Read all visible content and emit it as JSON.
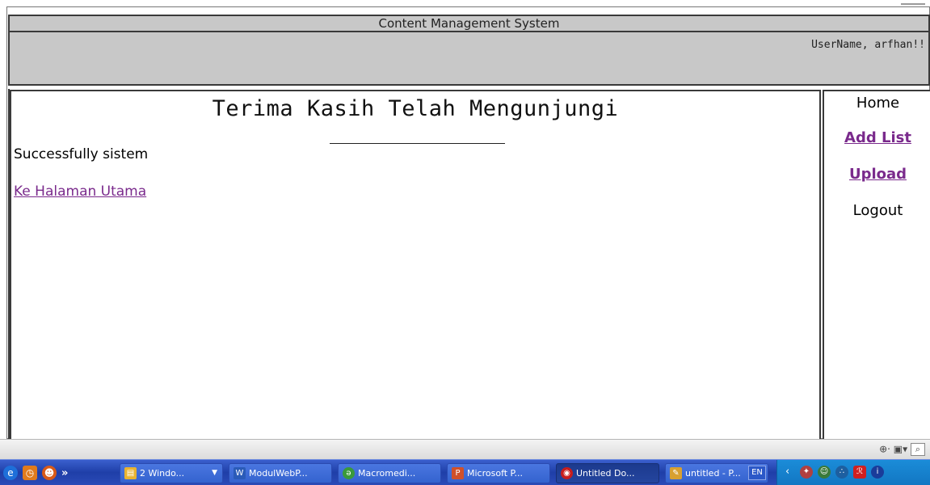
{
  "header": {
    "title": "Content Management System",
    "user_greeting": "UserName, arfhan!!"
  },
  "main": {
    "heading": "Terima Kasih Telah Mengunjungi",
    "status_message": "Successfully sistem",
    "home_link": "Ke Halaman Utama"
  },
  "sidebar": {
    "items": [
      {
        "label": "Home",
        "is_link": false
      },
      {
        "label": "Add List",
        "is_link": true
      },
      {
        "label": "Upload",
        "is_link": true
      },
      {
        "label": "Logout",
        "is_link": false
      }
    ]
  },
  "status_strip": {
    "icons": [
      "page-tool-icon",
      "camera-icon",
      "search-icon"
    ]
  },
  "taskbar": {
    "quick_launch": [
      "ie-icon",
      "clock-icon",
      "firefox-icon"
    ],
    "more": "»",
    "tasks": [
      {
        "label": "2 Windo...",
        "icon": "folder-icon",
        "active": false,
        "has_arrow": true
      },
      {
        "label": "ModulWebP...",
        "icon": "word-icon",
        "active": false,
        "has_arrow": false
      },
      {
        "label": "Macromedi...",
        "icon": "dreamweaver-icon",
        "active": false,
        "has_arrow": false
      },
      {
        "label": "Microsoft P...",
        "icon": "powerpoint-icon",
        "active": false,
        "has_arrow": false
      },
      {
        "label": "Untitled Do...",
        "icon": "browser-icon",
        "active": true,
        "has_arrow": false
      },
      {
        "label": "untitled - P...",
        "icon": "paint-icon",
        "active": false,
        "has_arrow": false
      }
    ],
    "language": "EN",
    "tray_icons": [
      "network-icon",
      "messenger-icon",
      "shield-icon",
      "acrobat-icon",
      "info-icon"
    ]
  },
  "colors": {
    "header_bg": "#c8c8c8",
    "link": "#7a2a8c",
    "taskbar": "#2a4ab8",
    "tray": "#1b8cd8"
  }
}
